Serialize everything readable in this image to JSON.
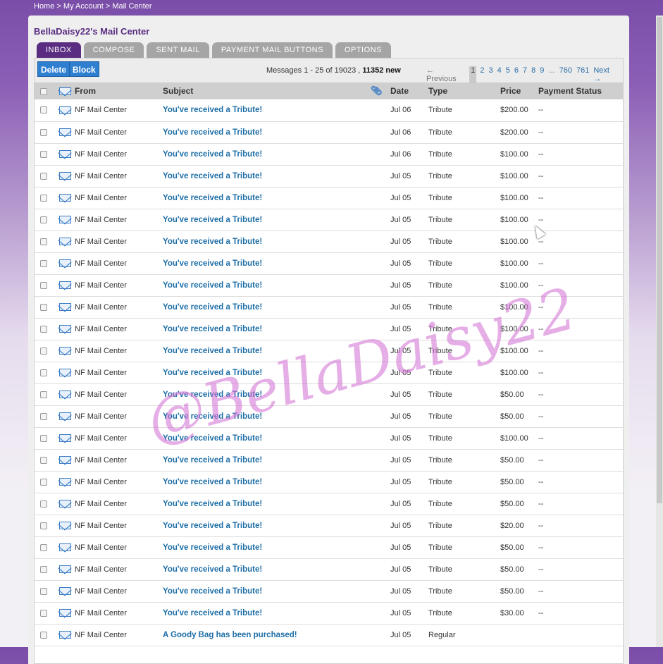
{
  "breadcrumb": {
    "home": "Home",
    "sep1": ">",
    "account": "My Account",
    "sep2": ">",
    "current": "Mail Center"
  },
  "title": "BellaDaisy22's Mail Center",
  "tabs": [
    {
      "label": "INBOX",
      "active": true
    },
    {
      "label": "COMPOSE",
      "active": false
    },
    {
      "label": "SENT MAIL",
      "active": false
    },
    {
      "label": "PAYMENT MAIL BUTTONS",
      "active": false
    },
    {
      "label": "OPTIONS",
      "active": false
    }
  ],
  "toolbar": {
    "delete_label": "Delete",
    "block_label": "Block",
    "messages_prefix": "Messages 1 - 25 of 19023 ,",
    "new_count": "11352 new"
  },
  "pager": {
    "previous": "← Previous",
    "current": "1",
    "pages": [
      "2",
      "3",
      "4",
      "5",
      "6",
      "7",
      "8",
      "9"
    ],
    "ellipsis": "...",
    "last_pages": [
      "760",
      "761"
    ],
    "next": "Next →"
  },
  "columns": {
    "from": "From",
    "subject": "Subject",
    "date": "Date",
    "type": "Type",
    "price": "Price",
    "payment_status": "Payment Status"
  },
  "messages": [
    {
      "from": "NF Mail Center",
      "subject": "You've received a Tribute!",
      "date": "Jul 06",
      "type": "Tribute",
      "price": "$200.00",
      "status": "--"
    },
    {
      "from": "NF Mail Center",
      "subject": "You've received a Tribute!",
      "date": "Jul 06",
      "type": "Tribute",
      "price": "$200.00",
      "status": "--"
    },
    {
      "from": "NF Mail Center",
      "subject": "You've received a Tribute!",
      "date": "Jul 06",
      "type": "Tribute",
      "price": "$100.00",
      "status": "--"
    },
    {
      "from": "NF Mail Center",
      "subject": "You've received a Tribute!",
      "date": "Jul 05",
      "type": "Tribute",
      "price": "$100.00",
      "status": "--"
    },
    {
      "from": "NF Mail Center",
      "subject": "You've received a Tribute!",
      "date": "Jul 05",
      "type": "Tribute",
      "price": "$100.00",
      "status": "--"
    },
    {
      "from": "NF Mail Center",
      "subject": "You've received a Tribute!",
      "date": "Jul 05",
      "type": "Tribute",
      "price": "$100.00",
      "status": "--"
    },
    {
      "from": "NF Mail Center",
      "subject": "You've received a Tribute!",
      "date": "Jul 05",
      "type": "Tribute",
      "price": "$100.00",
      "status": "--"
    },
    {
      "from": "NF Mail Center",
      "subject": "You've received a Tribute!",
      "date": "Jul 05",
      "type": "Tribute",
      "price": "$100.00",
      "status": "--"
    },
    {
      "from": "NF Mail Center",
      "subject": "You've received a Tribute!",
      "date": "Jul 05",
      "type": "Tribute",
      "price": "$100.00",
      "status": "--"
    },
    {
      "from": "NF Mail Center",
      "subject": "You've received a Tribute!",
      "date": "Jul 05",
      "type": "Tribute",
      "price": "$100.00",
      "status": "--"
    },
    {
      "from": "NF Mail Center",
      "subject": "You've received a Tribute!",
      "date": "Jul 05",
      "type": "Tribute",
      "price": "$100.00",
      "status": "--"
    },
    {
      "from": "NF Mail Center",
      "subject": "You've received a Tribute!",
      "date": "Jul 05",
      "type": "Tribute",
      "price": "$100.00",
      "status": "--"
    },
    {
      "from": "NF Mail Center",
      "subject": "You've received a Tribute!",
      "date": "Jul 05",
      "type": "Tribute",
      "price": "$100.00",
      "status": "--"
    },
    {
      "from": "NF Mail Center",
      "subject": "You've received a Tribute!",
      "date": "Jul 05",
      "type": "Tribute",
      "price": "$50.00",
      "status": "--"
    },
    {
      "from": "NF Mail Center",
      "subject": "You've received a Tribute!",
      "date": "Jul 05",
      "type": "Tribute",
      "price": "$50.00",
      "status": "--"
    },
    {
      "from": "NF Mail Center",
      "subject": "You've received a Tribute!",
      "date": "Jul 05",
      "type": "Tribute",
      "price": "$100.00",
      "status": "--"
    },
    {
      "from": "NF Mail Center",
      "subject": "You've received a Tribute!",
      "date": "Jul 05",
      "type": "Tribute",
      "price": "$50.00",
      "status": "--"
    },
    {
      "from": "NF Mail Center",
      "subject": "You've received a Tribute!",
      "date": "Jul 05",
      "type": "Tribute",
      "price": "$50.00",
      "status": "--"
    },
    {
      "from": "NF Mail Center",
      "subject": "You've received a Tribute!",
      "date": "Jul 05",
      "type": "Tribute",
      "price": "$50.00",
      "status": "--"
    },
    {
      "from": "NF Mail Center",
      "subject": "You've received a Tribute!",
      "date": "Jul 05",
      "type": "Tribute",
      "price": "$20.00",
      "status": "--"
    },
    {
      "from": "NF Mail Center",
      "subject": "You've received a Tribute!",
      "date": "Jul 05",
      "type": "Tribute",
      "price": "$50.00",
      "status": "--"
    },
    {
      "from": "NF Mail Center",
      "subject": "You've received a Tribute!",
      "date": "Jul 05",
      "type": "Tribute",
      "price": "$50.00",
      "status": "--"
    },
    {
      "from": "NF Mail Center",
      "subject": "You've received a Tribute!",
      "date": "Jul 05",
      "type": "Tribute",
      "price": "$50.00",
      "status": "--"
    },
    {
      "from": "NF Mail Center",
      "subject": "You've received a Tribute!",
      "date": "Jul 05",
      "type": "Tribute",
      "price": "$30.00",
      "status": "--"
    },
    {
      "from": "NF Mail Center",
      "subject": "A Goody Bag has been purchased!",
      "date": "Jul 05",
      "type": "Regular",
      "price": "",
      "status": ""
    }
  ],
  "watermark": "@BellaDaisy22",
  "colors": {
    "tab_active": "#5a2d82",
    "tab_inactive": "#a5a5a5",
    "button": "#2f7fd1",
    "subject_link": "#1e6ea7"
  }
}
